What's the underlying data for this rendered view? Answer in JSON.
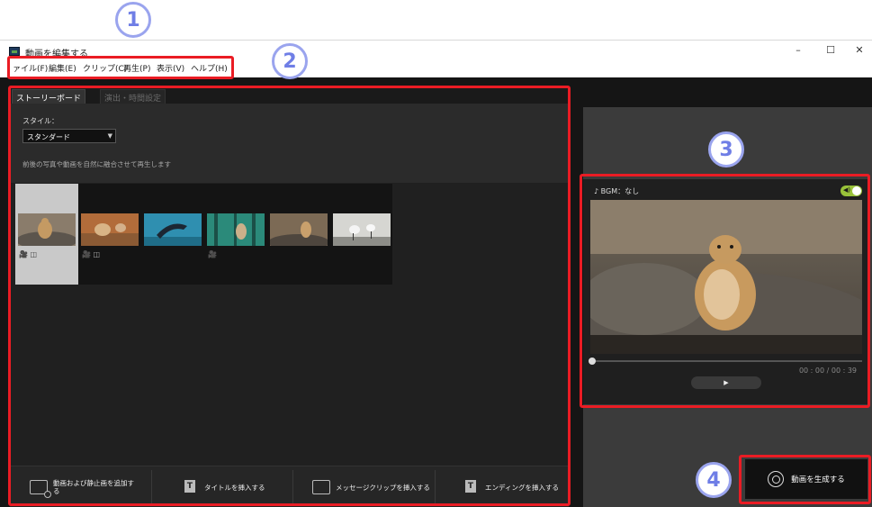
{
  "window": {
    "title": "動画を編集する",
    "minimize": "–",
    "maximize": "☐",
    "close": "✕"
  },
  "menu": [
    "ァイル(F)",
    "編集(E)",
    "クリップ(C)",
    "再生(P)",
    "表示(V)",
    "ヘルプ(H)"
  ],
  "tabs": {
    "storyboard": "ストーリーボード",
    "effects": "演出・時間設定"
  },
  "style": {
    "label": "スタイル：",
    "value": "スタンダード",
    "description": "前後の写真や動画を自然に融合させて再生します"
  },
  "clips": [
    {
      "icons": "🎥 ◫",
      "selected": true
    },
    {
      "icons": "🎥 ◫",
      "selected": false
    },
    {
      "icons": "",
      "selected": false
    },
    {
      "icons": "🎥",
      "selected": false
    },
    {
      "icons": "",
      "selected": false
    },
    {
      "icons": "",
      "selected": false
    }
  ],
  "actions": {
    "add_media": "動画および静止画を追加す\nる",
    "insert_title": "タイトルを挿入する",
    "insert_message": "メッセージクリップを挿入する",
    "insert_ending": "エンディングを挿入する"
  },
  "preview": {
    "bgm": "♪ BGM：なし",
    "time": "00 : 00 / 00 : 39",
    "play": "▶",
    "bgm_enabled": true,
    "position_fraction": 0
  },
  "generate": {
    "label": "動画を生成する"
  },
  "callouts": [
    "1",
    "2",
    "3",
    "4"
  ],
  "colors": {
    "highlight": "#ea1c24",
    "callout": "#9aa4ee",
    "toggle": "#99c23a"
  }
}
